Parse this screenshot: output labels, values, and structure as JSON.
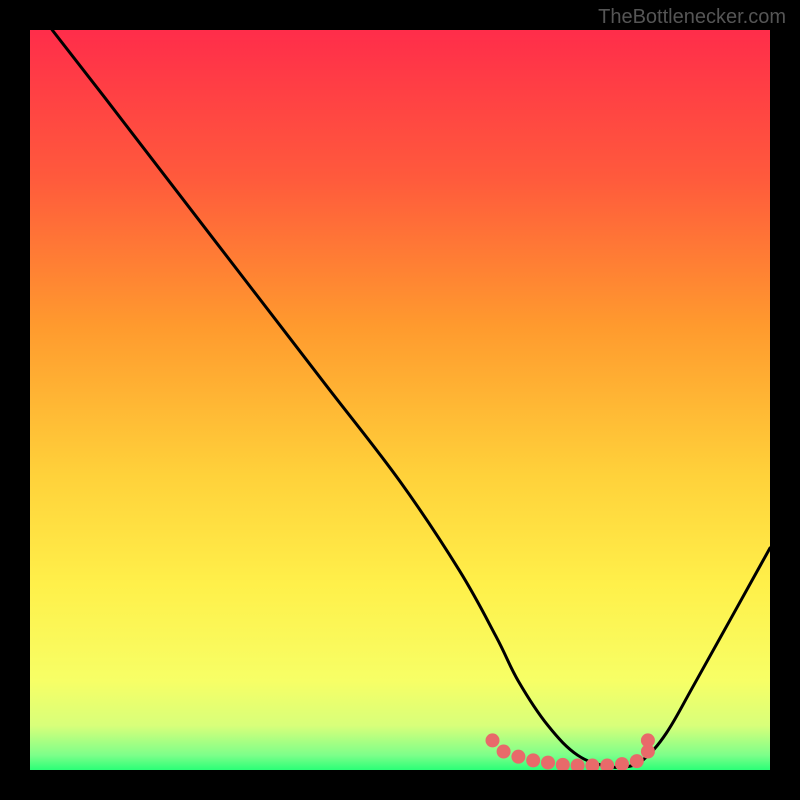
{
  "watermark": "TheBottlenecker.com",
  "chart_data": {
    "type": "line",
    "title": "",
    "xlabel": "",
    "ylabel": "",
    "xlim": [
      0,
      100
    ],
    "ylim": [
      0,
      100
    ],
    "series": [
      {
        "name": "curve",
        "x": [
          3,
          10,
          20,
          30,
          40,
          50,
          58,
          63,
          66,
          70,
          74,
          78,
          81,
          83,
          86,
          90,
          100
        ],
        "values": [
          100,
          91,
          78,
          65,
          52,
          39,
          27,
          18,
          12,
          6,
          2,
          0.5,
          0.5,
          1.5,
          5,
          12,
          30
        ]
      }
    ],
    "highlight": {
      "x": [
        62.5,
        64,
        66,
        68,
        70,
        72,
        74,
        76,
        78,
        80,
        82,
        83.5,
        83.5
      ],
      "values": [
        4,
        2.5,
        1.8,
        1.3,
        1.0,
        0.7,
        0.6,
        0.6,
        0.6,
        0.8,
        1.2,
        2.5,
        4
      ]
    },
    "gradient_stops": [
      {
        "offset": 0,
        "color": "#ff2d4a"
      },
      {
        "offset": 20,
        "color": "#ff5a3c"
      },
      {
        "offset": 40,
        "color": "#ff9a2e"
      },
      {
        "offset": 60,
        "color": "#ffd13a"
      },
      {
        "offset": 75,
        "color": "#fff04a"
      },
      {
        "offset": 88,
        "color": "#f7ff66"
      },
      {
        "offset": 94,
        "color": "#d8ff7a"
      },
      {
        "offset": 98,
        "color": "#7dff8a"
      },
      {
        "offset": 100,
        "color": "#2bff77"
      }
    ]
  }
}
